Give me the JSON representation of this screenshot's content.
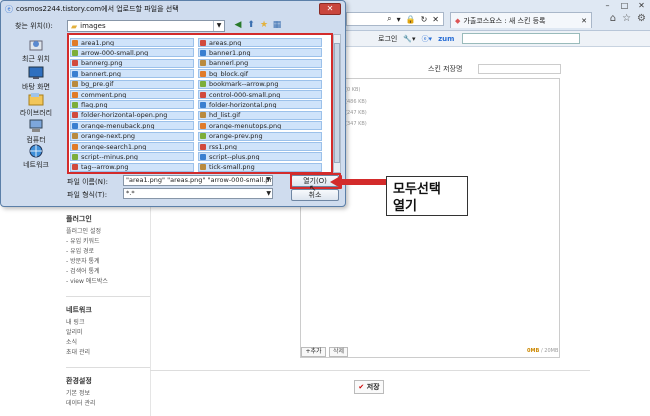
{
  "browser": {
    "tab_title": "가출코스요스 : 새 스킨 등록",
    "toolbar": {
      "login": "로그인",
      "zum": "zum"
    }
  },
  "sidebar": {
    "groups": [
      {
        "heading": "플러그인",
        "items": [
          "플러그인 설정",
          "- 유입 키워드",
          "- 유입 경로",
          "- 방문자 통계",
          "- 검색어 통계",
          "- view 애드박스"
        ]
      },
      {
        "heading": "네트워크",
        "items": [
          "내 링크",
          "알리미",
          "소식",
          "초대 관리"
        ]
      },
      {
        "heading": "환경설정",
        "items": [
          "기본 정보",
          "데이터 관리"
        ]
      }
    ]
  },
  "main": {
    "skin_name_label": "스킨 저장명",
    "file_sizes": [
      "(0 KB)",
      "(486 KB)",
      "(247 KB)",
      "(347 KB)"
    ],
    "add_button": "+추가",
    "delete_button": "삭제",
    "size_used": "0MB",
    "size_total": "/ 20MB",
    "save_button": "저장"
  },
  "dialog": {
    "title": "cosmos2244.tistory.com에서 업로드할 파일을 선택",
    "lookin_label": "찾는 위치(I):",
    "lookin_value": "images",
    "places": [
      "최근 위치",
      "바탕 화면",
      "라이브러리",
      "컴퓨터",
      "네트워크"
    ],
    "files_left": [
      "area1.png",
      "arrow-000-small.png",
      "bannerg.png",
      "bannert.png",
      "bg_pre.gif",
      "comment.png",
      "flag.png",
      "folder-horizontal-open.png",
      "orange-menuback.png",
      "orange-next.png",
      "orange-search1.png",
      "script--minus.png",
      "tag--arrow.png"
    ],
    "files_right": [
      "areas.png",
      "banner1.png",
      "bannerl.png",
      "bg_block.gif",
      "bookmark--arrow.png",
      "control-000-small.png",
      "folder-horizontal.png",
      "hd_list.gif",
      "orange-menutops.png",
      "orange-prev.png",
      "rss1.png",
      "script--plus.png",
      "tick-small.png"
    ],
    "filename_label": "파일 이름(N):",
    "filename_value": "\"area1.png\" \"areas.png\" \"arrow-000-small.png\" \"b",
    "filetype_label": "파일 형식(T):",
    "filetype_value": "*.*",
    "open_button": "열기(O)",
    "cancel_button": "취소"
  },
  "annotation": {
    "line1": "모두선택",
    "line2": "열기"
  },
  "colors": {
    "highlight_red": "#d32b2b",
    "selection_blue": "#cfe3fa",
    "dialog_frame": "#cfdcee"
  }
}
